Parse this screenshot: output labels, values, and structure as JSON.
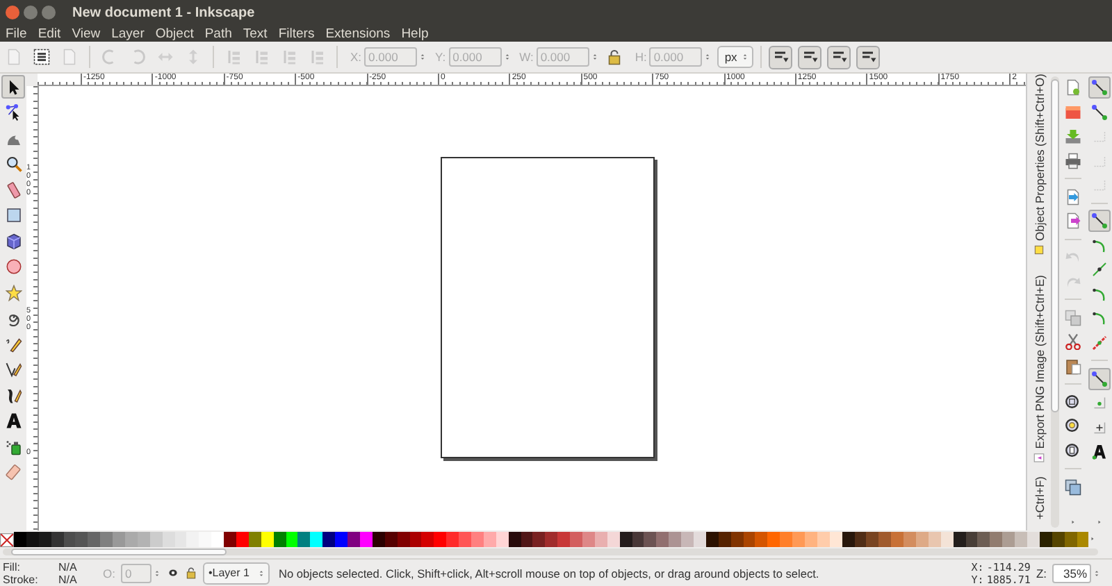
{
  "window": {
    "title": "New document 1 - Inkscape"
  },
  "menu": [
    "File",
    "Edit",
    "View",
    "Layer",
    "Object",
    "Path",
    "Text",
    "Filters",
    "Extensions",
    "Help"
  ],
  "toolbar": {
    "buttons": [
      {
        "disabled": true
      },
      {
        "disabled": false
      },
      {
        "disabled": true
      },
      {
        "disabled": true
      },
      {
        "disabled": true
      },
      {
        "disabled": true
      },
      {
        "disabled": true
      },
      {
        "disabled": true
      },
      {
        "disabled": true
      },
      {
        "disabled": true
      },
      {
        "disabled": true
      }
    ],
    "fields": [
      {
        "label": "X:",
        "value": "0.000",
        "disabled": true
      },
      {
        "label": "Y:",
        "value": "0.000",
        "disabled": true
      },
      {
        "label": "W:",
        "value": "0.000",
        "disabled": true
      },
      {
        "label": "H:",
        "value": "0.000",
        "disabled": true
      }
    ],
    "unit": "px",
    "toggles": [
      {
        "on": true
      },
      {
        "on": true
      },
      {
        "on": true
      },
      {
        "on": true
      }
    ]
  },
  "tools": [
    {
      "selected": true
    },
    {
      "selected": false
    },
    {
      "selected": false
    },
    {
      "selected": false
    },
    {
      "selected": false
    },
    {
      "selected": false
    },
    {
      "selected": false
    },
    {
      "selected": false
    },
    {
      "selected": false
    },
    {
      "selected": false
    },
    {
      "selected": false
    },
    {
      "selected": false
    },
    {
      "selected": false
    },
    {
      "selected": false
    },
    {
      "selected": false
    },
    {
      "selected": false
    }
  ],
  "rulers": {
    "horizontal": [
      "-1250",
      "-1000",
      "-750",
      "-500",
      "-250",
      "0",
      "250",
      "500",
      "750",
      "1000",
      "1250",
      "1500",
      "1750",
      "2"
    ],
    "vertical": [
      "1000",
      "500",
      "0"
    ]
  },
  "dock": {
    "tabs": [
      {
        "label": "Object Properties (Shift+Ctrl+O)"
      },
      {
        "label": "Export PNG Image (Shift+Ctrl+E)"
      },
      {
        "label": "+Ctrl+F)"
      }
    ]
  },
  "snap_bar": [
    {
      "on": true,
      "disabled": false
    },
    {
      "on": false,
      "disabled": false
    },
    {
      "on": false,
      "disabled": true
    },
    {
      "on": false,
      "disabled": true
    },
    {
      "on": false,
      "disabled": true
    },
    {
      "on": true,
      "disabled": false
    },
    {
      "on": false,
      "disabled": false
    },
    {
      "on": false,
      "disabled": false
    },
    {
      "on": false,
      "disabled": false
    },
    {
      "on": false,
      "disabled": false
    },
    {
      "on": false,
      "disabled": false
    },
    {
      "on": true,
      "disabled": false
    },
    {
      "on": false,
      "disabled": false
    },
    {
      "on": false,
      "disabled": false
    },
    {
      "on": false,
      "disabled": false
    }
  ],
  "palette": [
    {
      "color": "#000000"
    },
    {
      "color": "#111111"
    },
    {
      "color": "#1a1a1a"
    },
    {
      "color": "#333333"
    },
    {
      "color": "#4d4d4d"
    },
    {
      "color": "#555555"
    },
    {
      "color": "#666666"
    },
    {
      "color": "#808080"
    },
    {
      "color": "#999999"
    },
    {
      "color": "#aaaaaa"
    },
    {
      "color": "#b3b3b3"
    },
    {
      "color": "#cccccc"
    },
    {
      "color": "#dddddd"
    },
    {
      "color": "#e6e6e6"
    },
    {
      "color": "#f2f2f2"
    },
    {
      "color": "#f9f9f9"
    },
    {
      "color": "#ffffff"
    },
    {
      "color": "#800000"
    },
    {
      "color": "#ff0000"
    },
    {
      "color": "#808000"
    },
    {
      "color": "#ffff00"
    },
    {
      "color": "#008000"
    },
    {
      "color": "#00ff00"
    },
    {
      "color": "#008080"
    },
    {
      "color": "#00ffff"
    },
    {
      "color": "#000080"
    },
    {
      "color": "#0000ff"
    },
    {
      "color": "#800080"
    },
    {
      "color": "#ff00ff"
    },
    {
      "color": "#2b0000"
    },
    {
      "color": "#550000"
    },
    {
      "color": "#800000"
    },
    {
      "color": "#aa0000"
    },
    {
      "color": "#d40000"
    },
    {
      "color": "#ff0000"
    },
    {
      "color": "#ff2a2a"
    },
    {
      "color": "#ff5555"
    },
    {
      "color": "#ff8080"
    },
    {
      "color": "#ffaaaa"
    },
    {
      "color": "#ffd5d5"
    },
    {
      "color": "#280b0b"
    },
    {
      "color": "#501616"
    },
    {
      "color": "#782121"
    },
    {
      "color": "#a02c2c"
    },
    {
      "color": "#c83737"
    },
    {
      "color": "#d35f5f"
    },
    {
      "color": "#de8787"
    },
    {
      "color": "#e9afaf"
    },
    {
      "color": "#f4d7d7"
    },
    {
      "color": "#241c1c"
    },
    {
      "color": "#483737"
    },
    {
      "color": "#6c5353"
    },
    {
      "color": "#916f6f"
    },
    {
      "color": "#ac9393"
    },
    {
      "color": "#c8b7b7"
    },
    {
      "color": "#e3dbdb"
    },
    {
      "color": "#2b1100"
    },
    {
      "color": "#552200"
    },
    {
      "color": "#803300"
    },
    {
      "color": "#aa4400"
    },
    {
      "color": "#d45500"
    },
    {
      "color": "#ff6600"
    },
    {
      "color": "#ff7f2a"
    },
    {
      "color": "#ff9955"
    },
    {
      "color": "#ffb380"
    },
    {
      "color": "#ffccaa"
    },
    {
      "color": "#ffe6d5"
    },
    {
      "color": "#28170b"
    },
    {
      "color": "#502d16"
    },
    {
      "color": "#784421"
    },
    {
      "color": "#a05a2c"
    },
    {
      "color": "#c87137"
    },
    {
      "color": "#d38d5f"
    },
    {
      "color": "#deaa87"
    },
    {
      "color": "#e9c6af"
    },
    {
      "color": "#f4e3d7"
    },
    {
      "color": "#241f1c"
    },
    {
      "color": "#483e37"
    },
    {
      "color": "#6c5d53"
    },
    {
      "color": "#917c6f"
    },
    {
      "color": "#ac9d93"
    },
    {
      "color": "#c8beb7"
    },
    {
      "color": "#e3dedb"
    },
    {
      "color": "#2b2200"
    },
    {
      "color": "#554400"
    },
    {
      "color": "#806600"
    },
    {
      "color": "#aa8800"
    }
  ],
  "status_bar": {
    "fill_label": "Fill:",
    "fill_value": "N/A",
    "stroke_label": "Stroke:",
    "stroke_value": "N/A",
    "opacity_label": "O:",
    "opacity_value": "0",
    "opacity_disabled": true,
    "layer": "•Layer 1",
    "message": "No objects selected. Click, Shift+click, Alt+scroll mouse on top of objects, or drag around objects to select.",
    "x_label": "X:",
    "x_value": "-114.29",
    "y_label": "Y:",
    "y_value": "1885.71",
    "zoom_label": "Z:",
    "zoom_value": "35%"
  }
}
